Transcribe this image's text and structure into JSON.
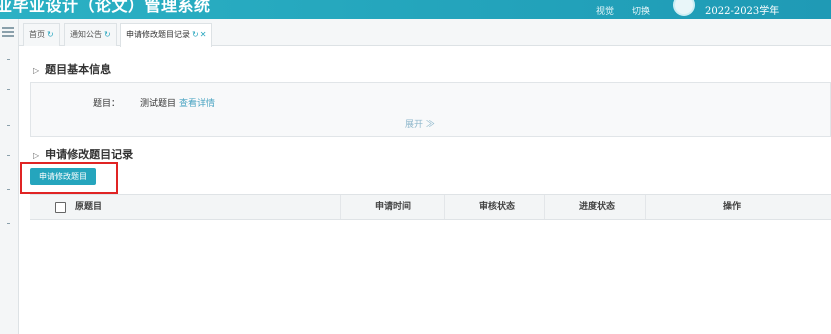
{
  "header": {
    "title": "业毕业设计（论文）管理系统",
    "links": [
      "视觉",
      "切换"
    ],
    "academic_year": "2022-2023学年"
  },
  "tabs": [
    {
      "label": "首页",
      "icon": "refresh-icon"
    },
    {
      "label": "通知公告",
      "icon": "refresh-icon"
    },
    {
      "label": "申请修改题目记录",
      "icon": "refresh-icon",
      "active": true
    }
  ],
  "basic_info": {
    "section_title": "题目基本信息",
    "topic_label": "题目：",
    "topic_value": "测试题目",
    "detail_link": "查看详情",
    "expand_label": "展开 ≫"
  },
  "records": {
    "section_title": "申请修改题目记录",
    "apply_button": "申请修改题目",
    "columns": [
      "原题目",
      "申请时间",
      "审核状态",
      "进度状态",
      "操作"
    ]
  },
  "colors": {
    "accent": "#25a5bd",
    "highlight": "#e02424"
  }
}
